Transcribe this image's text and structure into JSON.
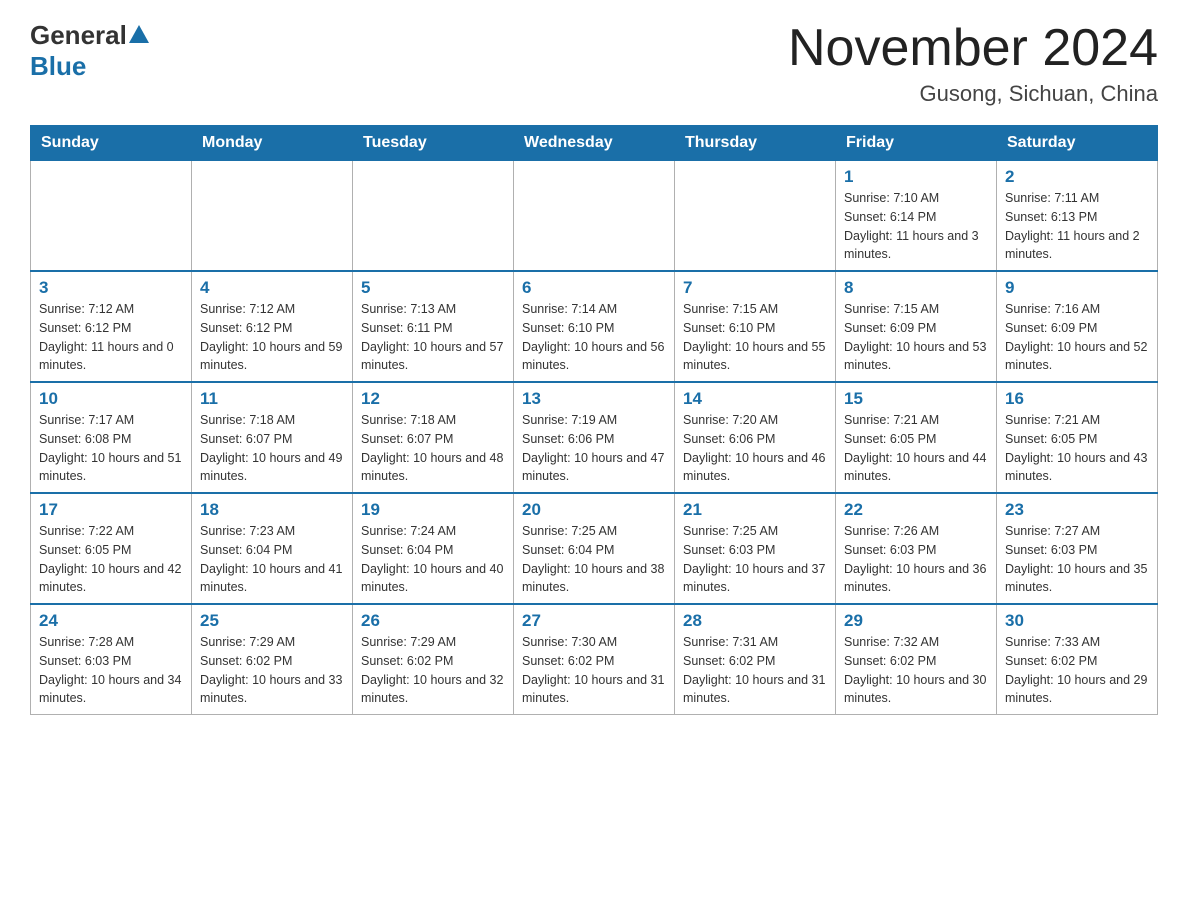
{
  "header": {
    "logo_general": "General",
    "logo_blue": "Blue",
    "month_title": "November 2024",
    "location": "Gusong, Sichuan, China"
  },
  "weekdays": [
    "Sunday",
    "Monday",
    "Tuesday",
    "Wednesday",
    "Thursday",
    "Friday",
    "Saturday"
  ],
  "weeks": [
    [
      {
        "day": "",
        "info": ""
      },
      {
        "day": "",
        "info": ""
      },
      {
        "day": "",
        "info": ""
      },
      {
        "day": "",
        "info": ""
      },
      {
        "day": "",
        "info": ""
      },
      {
        "day": "1",
        "info": "Sunrise: 7:10 AM\nSunset: 6:14 PM\nDaylight: 11 hours and 3 minutes."
      },
      {
        "day": "2",
        "info": "Sunrise: 7:11 AM\nSunset: 6:13 PM\nDaylight: 11 hours and 2 minutes."
      }
    ],
    [
      {
        "day": "3",
        "info": "Sunrise: 7:12 AM\nSunset: 6:12 PM\nDaylight: 11 hours and 0 minutes."
      },
      {
        "day": "4",
        "info": "Sunrise: 7:12 AM\nSunset: 6:12 PM\nDaylight: 10 hours and 59 minutes."
      },
      {
        "day": "5",
        "info": "Sunrise: 7:13 AM\nSunset: 6:11 PM\nDaylight: 10 hours and 57 minutes."
      },
      {
        "day": "6",
        "info": "Sunrise: 7:14 AM\nSunset: 6:10 PM\nDaylight: 10 hours and 56 minutes."
      },
      {
        "day": "7",
        "info": "Sunrise: 7:15 AM\nSunset: 6:10 PM\nDaylight: 10 hours and 55 minutes."
      },
      {
        "day": "8",
        "info": "Sunrise: 7:15 AM\nSunset: 6:09 PM\nDaylight: 10 hours and 53 minutes."
      },
      {
        "day": "9",
        "info": "Sunrise: 7:16 AM\nSunset: 6:09 PM\nDaylight: 10 hours and 52 minutes."
      }
    ],
    [
      {
        "day": "10",
        "info": "Sunrise: 7:17 AM\nSunset: 6:08 PM\nDaylight: 10 hours and 51 minutes."
      },
      {
        "day": "11",
        "info": "Sunrise: 7:18 AM\nSunset: 6:07 PM\nDaylight: 10 hours and 49 minutes."
      },
      {
        "day": "12",
        "info": "Sunrise: 7:18 AM\nSunset: 6:07 PM\nDaylight: 10 hours and 48 minutes."
      },
      {
        "day": "13",
        "info": "Sunrise: 7:19 AM\nSunset: 6:06 PM\nDaylight: 10 hours and 47 minutes."
      },
      {
        "day": "14",
        "info": "Sunrise: 7:20 AM\nSunset: 6:06 PM\nDaylight: 10 hours and 46 minutes."
      },
      {
        "day": "15",
        "info": "Sunrise: 7:21 AM\nSunset: 6:05 PM\nDaylight: 10 hours and 44 minutes."
      },
      {
        "day": "16",
        "info": "Sunrise: 7:21 AM\nSunset: 6:05 PM\nDaylight: 10 hours and 43 minutes."
      }
    ],
    [
      {
        "day": "17",
        "info": "Sunrise: 7:22 AM\nSunset: 6:05 PM\nDaylight: 10 hours and 42 minutes."
      },
      {
        "day": "18",
        "info": "Sunrise: 7:23 AM\nSunset: 6:04 PM\nDaylight: 10 hours and 41 minutes."
      },
      {
        "day": "19",
        "info": "Sunrise: 7:24 AM\nSunset: 6:04 PM\nDaylight: 10 hours and 40 minutes."
      },
      {
        "day": "20",
        "info": "Sunrise: 7:25 AM\nSunset: 6:04 PM\nDaylight: 10 hours and 38 minutes."
      },
      {
        "day": "21",
        "info": "Sunrise: 7:25 AM\nSunset: 6:03 PM\nDaylight: 10 hours and 37 minutes."
      },
      {
        "day": "22",
        "info": "Sunrise: 7:26 AM\nSunset: 6:03 PM\nDaylight: 10 hours and 36 minutes."
      },
      {
        "day": "23",
        "info": "Sunrise: 7:27 AM\nSunset: 6:03 PM\nDaylight: 10 hours and 35 minutes."
      }
    ],
    [
      {
        "day": "24",
        "info": "Sunrise: 7:28 AM\nSunset: 6:03 PM\nDaylight: 10 hours and 34 minutes."
      },
      {
        "day": "25",
        "info": "Sunrise: 7:29 AM\nSunset: 6:02 PM\nDaylight: 10 hours and 33 minutes."
      },
      {
        "day": "26",
        "info": "Sunrise: 7:29 AM\nSunset: 6:02 PM\nDaylight: 10 hours and 32 minutes."
      },
      {
        "day": "27",
        "info": "Sunrise: 7:30 AM\nSunset: 6:02 PM\nDaylight: 10 hours and 31 minutes."
      },
      {
        "day": "28",
        "info": "Sunrise: 7:31 AM\nSunset: 6:02 PM\nDaylight: 10 hours and 31 minutes."
      },
      {
        "day": "29",
        "info": "Sunrise: 7:32 AM\nSunset: 6:02 PM\nDaylight: 10 hours and 30 minutes."
      },
      {
        "day": "30",
        "info": "Sunrise: 7:33 AM\nSunset: 6:02 PM\nDaylight: 10 hours and 29 minutes."
      }
    ]
  ]
}
